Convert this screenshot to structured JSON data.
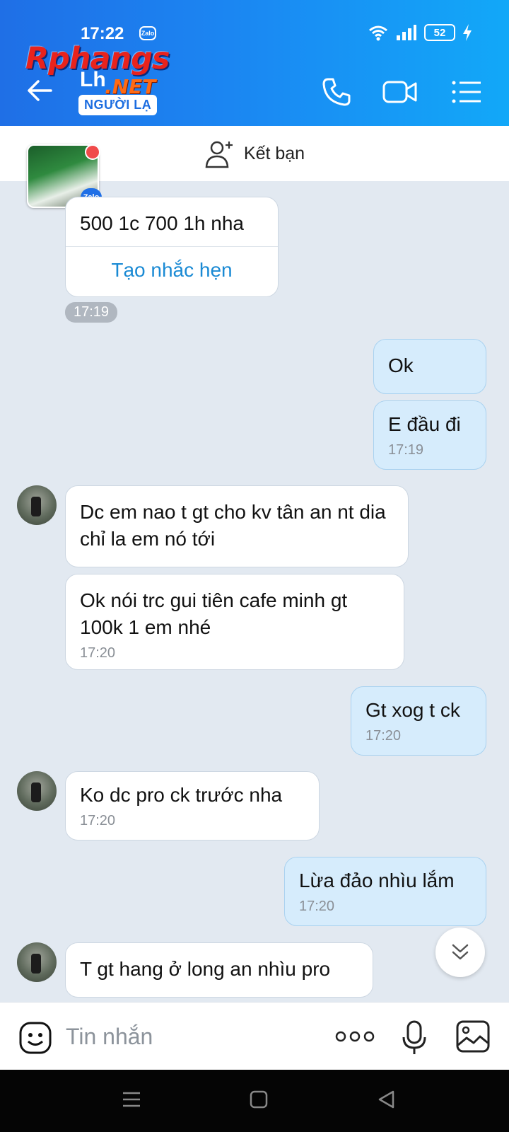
{
  "status_bar": {
    "time": "17:22",
    "zalo_badge": "Zalo",
    "battery": "52"
  },
  "watermark": {
    "brand": "Rphangs",
    "suffix": ".NET"
  },
  "header": {
    "contact_name": "Lh",
    "stranger_label": "NGƯỜI LẠ",
    "icons": [
      "back-arrow-icon",
      "phone-icon",
      "video-call-icon",
      "menu-list-icon"
    ]
  },
  "friend_bar": {
    "label": "Kết bạn"
  },
  "thumbnail": {
    "badge": "Zalo"
  },
  "messages": [
    {
      "side": "them",
      "text": "500 1c 700 1h nha",
      "action": "Tạo nhắc hẹn"
    },
    {
      "side": "chip",
      "time": "17:19"
    },
    {
      "side": "me",
      "text": "Ok"
    },
    {
      "side": "me",
      "text": "E đầu đi",
      "time": "17:19"
    },
    {
      "side": "them",
      "text": "Dc em nao t gt cho kv tân an nt dia chỉ la em nó tới"
    },
    {
      "side": "them",
      "text": "Ok nói trc gui tiên cafe minh gt 100k 1 em nhé",
      "time": "17:20"
    },
    {
      "side": "me",
      "text": "Gt xog t ck",
      "time": "17:20"
    },
    {
      "side": "them",
      "text": "Ko dc pro ck trước nha",
      "time": "17:20"
    },
    {
      "side": "me",
      "text": "Lừa đảo nhìu lắm",
      "time": "17:20"
    },
    {
      "side": "them",
      "text": "T gt hang ở long an nhìu pro"
    }
  ],
  "input": {
    "placeholder": "Tin nhắn"
  },
  "colors": {
    "header_start": "#1f6fe6",
    "header_end": "#12a8f8",
    "my_bubble": "#d6ecfc",
    "chat_bg": "#e2e9f1",
    "link": "#1a8ad4"
  }
}
